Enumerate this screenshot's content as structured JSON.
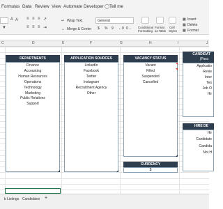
{
  "menu": [
    "Formulas",
    "Data",
    "Review",
    "View",
    "Automate",
    "Developer",
    "Tell me"
  ],
  "toolbar": {
    "wrap_text": "Wrap Text",
    "merge_center": "Merge & Center",
    "number_format": "General",
    "currency_symbol": "$",
    "percent_symbol": "%",
    "comma_symbol": "9",
    "conditional_formatting": [
      "Conditional",
      "Formatting"
    ],
    "format_as_table": [
      "Format",
      "as Table"
    ],
    "cell_styles": [
      "Cell",
      "Styles"
    ],
    "insert": "Insert",
    "delete": "Delete",
    "format": "Format"
  },
  "column_headers": [
    "C",
    "D",
    "E",
    "F",
    "G",
    "H",
    "I",
    "J"
  ],
  "tables": {
    "departments": {
      "title": "DEPARTMENTS",
      "items": [
        "Finance",
        "Accounting",
        "Human Resources",
        "Operations",
        "Technology",
        "Marketing",
        "Public Relations",
        "Support"
      ]
    },
    "application_sources": {
      "title": "APPLICATION SOURCES",
      "items": [
        "LinkedIn",
        "Facebook",
        "Twitter",
        "Instagram",
        "Recruitment Agency",
        "Other"
      ]
    },
    "vacancy_status": {
      "title": "VACANCY STATUS",
      "items": [
        "Vacant",
        "Filled",
        "Suspended",
        "Cancelled"
      ]
    },
    "currency": {
      "title": "CURRENCY",
      "value": "$"
    },
    "candidate_status": {
      "title_line1": "CANDIDAT",
      "title_line2": "(Para",
      "items": [
        "Applicatio",
        "Revie",
        "Inter",
        "Tes",
        "Job O",
        "Hir"
      ]
    },
    "hire_decision": {
      "title": "HIRE DE",
      "items": [
        "Hir",
        "Candidate",
        "Candida",
        "Not H"
      ]
    }
  },
  "sheet_tabs": [
    "b Listings",
    "Candidates"
  ],
  "add_sheet": "+",
  "colors": {
    "header_bg": "#2f3e4e",
    "border": "#8aa0b3",
    "accent_green": "#217346",
    "comment_red": "#d23b2b"
  }
}
